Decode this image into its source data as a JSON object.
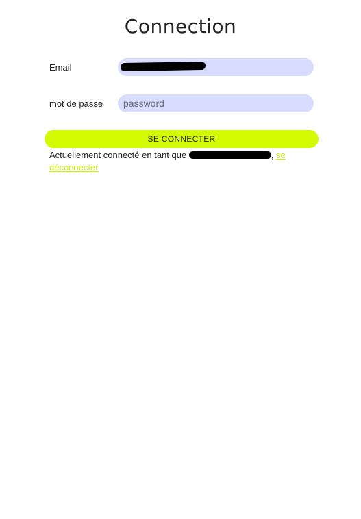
{
  "page": {
    "title": "Connection"
  },
  "form": {
    "email_label": "Email",
    "email_value": "",
    "password_label": "mot de passe",
    "password_placeholder": "password",
    "submit_label": "SE CONNECTER"
  },
  "status": {
    "prefix": "Actuellement connecté en tant que",
    "suffix": ",",
    "logout_label": "se déconnecter"
  },
  "colors": {
    "field_bg": "#d8dcfe",
    "accent": "#d3fa00",
    "link": "#c8ee10"
  }
}
